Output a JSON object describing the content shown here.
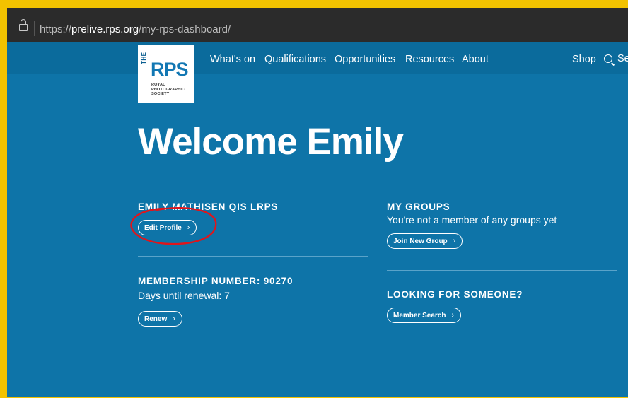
{
  "browser": {
    "url_prefix": "https://",
    "url_host": "prelive.rps.org",
    "url_path": "/my-rps-dashboard/"
  },
  "logo": {
    "the": "THE",
    "rps": "RPS",
    "sub_line1": "ROYAL",
    "sub_line2": "PHOTOGRAPHIC",
    "sub_line3": "SOCIETY"
  },
  "nav": {
    "items": [
      "What's on",
      "Qualifications",
      "Opportunities",
      "Resources",
      "About"
    ],
    "shop": "Shop",
    "search": "Se"
  },
  "welcome": "Welcome Emily",
  "profile": {
    "name": "EMILY MATHISEN QIS LRPS",
    "edit_label": "Edit Profile"
  },
  "membership": {
    "heading": "MEMBERSHIP NUMBER: 90270",
    "renewal_text": "Days until renewal: 7",
    "renew_label": "Renew"
  },
  "groups": {
    "heading": "MY GROUPS",
    "text": "You're not a member of any groups yet",
    "join_label": "Join New Group"
  },
  "search_people": {
    "heading": "LOOKING FOR SOMEONE?",
    "button_label": "Member Search"
  },
  "colors": {
    "page_bg": "#0e74a8",
    "frame": "#f2c200",
    "annotation": "#e0151b"
  },
  "icons": {
    "lock": "lock-icon",
    "search": "search-icon",
    "chevron": "chevron-right-icon"
  }
}
